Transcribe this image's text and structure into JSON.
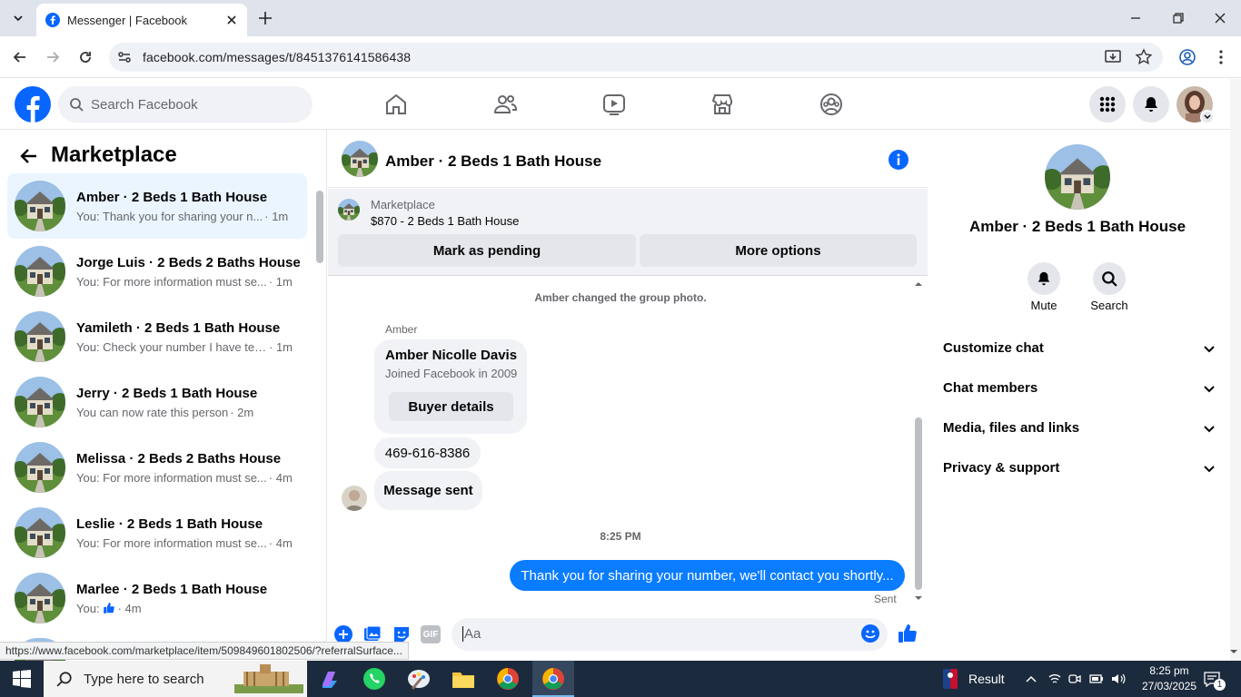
{
  "browser": {
    "tab_title": "Messenger | Facebook",
    "url": "facebook.com/messages/t/8451376141586438"
  },
  "fb": {
    "search_placeholder": "Search Facebook"
  },
  "sidebar": {
    "title": "Marketplace",
    "conversations": [
      {
        "name": "Amber · 2 Beds 1 Bath House",
        "preview": "You: Thank you for sharing your n...",
        "time": "· 1m"
      },
      {
        "name": "Jorge Luis · 2 Beds 2 Baths House",
        "preview": "You: For more information must se...",
        "time": "· 1m"
      },
      {
        "name": "Yamileth · 2 Beds 1 Bath House",
        "preview": "You: Check your number I have tex...",
        "time": "· 1m"
      },
      {
        "name": "Jerry · 2 Beds 1 Bath House",
        "preview": "You can now rate this person",
        "time": "· 2m"
      },
      {
        "name": "Melissa · 2 Beds 2 Baths House",
        "preview": "You: For more information must se...",
        "time": "· 4m"
      },
      {
        "name": "Leslie · 2 Beds 1 Bath House",
        "preview": "You: For more information must se...",
        "time": "· 4m"
      },
      {
        "name": "Marlee · 2 Beds 1 Bath House",
        "preview": "You: ",
        "time": "· 4m"
      }
    ]
  },
  "chat": {
    "header_name": "Amber · 2 Beds 1 Bath House",
    "marketplace_label": "Marketplace",
    "listing": "$870 - 2 Beds 1 Bath House",
    "mark_pending": "Mark as pending",
    "more_options": "More options",
    "event": "Amber changed the group photo.",
    "sender": "Amber",
    "card_name": "Amber Nicolle Davis",
    "card_sub": "Joined Facebook in 2009",
    "buyer_details": "Buyer details",
    "phone": "469-616-8386",
    "message_sent": "Message sent",
    "timestamp": "8:25 PM",
    "my_message": "Thank you for sharing your number, we'll contact you shortly...",
    "sent_status": "Sent",
    "composer_placeholder": "Aa"
  },
  "details": {
    "name": "Amber · 2 Beds 1 Bath House",
    "mute": "Mute",
    "search": "Search",
    "sections": [
      "Customize chat",
      "Chat members",
      "Media, files and links",
      "Privacy & support"
    ]
  },
  "status_url": "https://www.facebook.com/marketplace/item/509849601802506/?referralSurface...",
  "taskbar": {
    "search": "Type here to search",
    "result": "Result",
    "time": "8:25 pm",
    "date": "27/03/2025",
    "notif_count": "1"
  },
  "colors": {
    "fb_blue": "#0866ff",
    "messenger_blue": "#0a7cff",
    "taskbar": "#1c2a3d"
  }
}
